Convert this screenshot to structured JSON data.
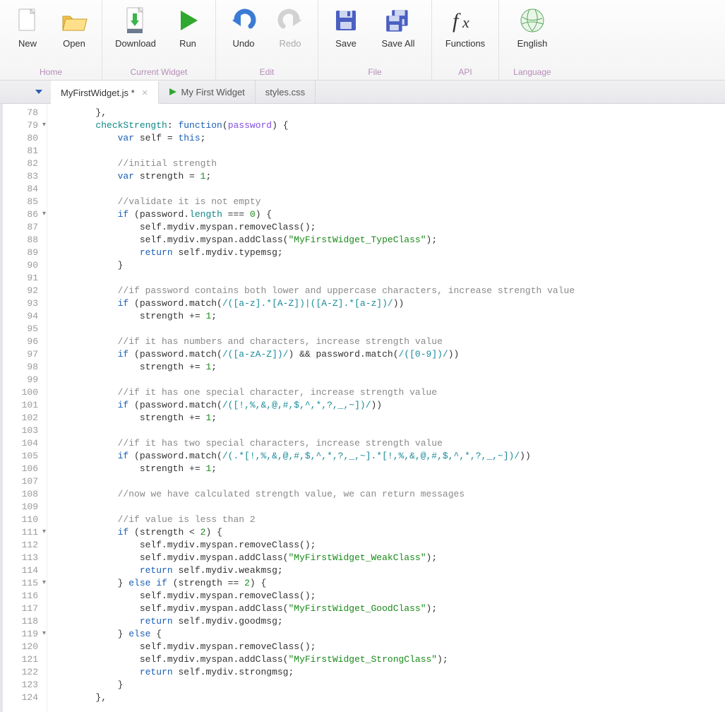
{
  "ribbon": {
    "groups": [
      {
        "label": "Home",
        "buttons": [
          {
            "id": "new",
            "label": "New"
          },
          {
            "id": "open",
            "label": "Open"
          }
        ]
      },
      {
        "label": "Current Widget",
        "buttons": [
          {
            "id": "download",
            "label": "Download"
          },
          {
            "id": "run",
            "label": "Run"
          }
        ]
      },
      {
        "label": "Edit",
        "buttons": [
          {
            "id": "undo",
            "label": "Undo"
          },
          {
            "id": "redo",
            "label": "Redo",
            "disabled": true
          }
        ]
      },
      {
        "label": "File",
        "buttons": [
          {
            "id": "save",
            "label": "Save"
          },
          {
            "id": "saveall",
            "label": "Save All"
          }
        ]
      },
      {
        "label": "API",
        "buttons": [
          {
            "id": "functions",
            "label": "Functions"
          }
        ]
      },
      {
        "label": "Language",
        "buttons": [
          {
            "id": "english",
            "label": "English"
          }
        ]
      }
    ]
  },
  "tabs": {
    "items": [
      {
        "label": "MyFirstWidget.js *",
        "active": true,
        "close": "×"
      },
      {
        "label": "My First Widget",
        "runnable": true
      },
      {
        "label": "styles.css"
      }
    ]
  },
  "editor": {
    "first_line": 78,
    "fold_lines": [
      79,
      86,
      111,
      115,
      119
    ],
    "lines": [
      [
        {
          "t": "        },",
          "c": ""
        }
      ],
      [
        {
          "t": "        ",
          "c": ""
        },
        {
          "t": "checkStrength",
          "c": "k-teal"
        },
        {
          "t": ": ",
          "c": ""
        },
        {
          "t": "function",
          "c": "k-blue"
        },
        {
          "t": "(",
          "c": ""
        },
        {
          "t": "password",
          "c": "k-purp"
        },
        {
          "t": ") {",
          "c": ""
        }
      ],
      [
        {
          "t": "            ",
          "c": ""
        },
        {
          "t": "var",
          "c": "k-blue"
        },
        {
          "t": " self = ",
          "c": ""
        },
        {
          "t": "this",
          "c": "k-blue"
        },
        {
          "t": ";",
          "c": ""
        }
      ],
      [
        {
          "t": "",
          "c": ""
        }
      ],
      [
        {
          "t": "            ",
          "c": ""
        },
        {
          "t": "//initial strength",
          "c": "k-com"
        }
      ],
      [
        {
          "t": "            ",
          "c": ""
        },
        {
          "t": "var",
          "c": "k-blue"
        },
        {
          "t": " strength = ",
          "c": ""
        },
        {
          "t": "1",
          "c": "k-num"
        },
        {
          "t": ";",
          "c": ""
        }
      ],
      [
        {
          "t": "",
          "c": ""
        }
      ],
      [
        {
          "t": "            ",
          "c": ""
        },
        {
          "t": "//validate it is not empty",
          "c": "k-com"
        }
      ],
      [
        {
          "t": "            ",
          "c": ""
        },
        {
          "t": "if",
          "c": "k-blue"
        },
        {
          "t": " (password.",
          "c": ""
        },
        {
          "t": "length",
          "c": "k-teal"
        },
        {
          "t": " === ",
          "c": ""
        },
        {
          "t": "0",
          "c": "k-num"
        },
        {
          "t": ") {",
          "c": ""
        }
      ],
      [
        {
          "t": "                self.mydiv.myspan.removeClass();",
          "c": ""
        }
      ],
      [
        {
          "t": "                self.mydiv.myspan.addClass(",
          "c": ""
        },
        {
          "t": "\"MyFirstWidget_TypeClass\"",
          "c": "k-str"
        },
        {
          "t": ");",
          "c": ""
        }
      ],
      [
        {
          "t": "                ",
          "c": ""
        },
        {
          "t": "return",
          "c": "k-blue"
        },
        {
          "t": " self.mydiv.typemsg;",
          "c": ""
        }
      ],
      [
        {
          "t": "            }",
          "c": ""
        }
      ],
      [
        {
          "t": "",
          "c": ""
        }
      ],
      [
        {
          "t": "            ",
          "c": ""
        },
        {
          "t": "//if password contains both lower and uppercase characters, increase strength value",
          "c": "k-com"
        }
      ],
      [
        {
          "t": "            ",
          "c": ""
        },
        {
          "t": "if",
          "c": "k-blue"
        },
        {
          "t": " (password.match(",
          "c": ""
        },
        {
          "t": "/([a-z].*[A-Z])|([A-Z].*[a-z])/",
          "c": "k-regex"
        },
        {
          "t": "))",
          "c": ""
        }
      ],
      [
        {
          "t": "                strength += ",
          "c": ""
        },
        {
          "t": "1",
          "c": "k-num"
        },
        {
          "t": ";",
          "c": ""
        }
      ],
      [
        {
          "t": "",
          "c": ""
        }
      ],
      [
        {
          "t": "            ",
          "c": ""
        },
        {
          "t": "//if it has numbers and characters, increase strength value",
          "c": "k-com"
        }
      ],
      [
        {
          "t": "            ",
          "c": ""
        },
        {
          "t": "if",
          "c": "k-blue"
        },
        {
          "t": " (password.match(",
          "c": ""
        },
        {
          "t": "/([a-zA-Z])/",
          "c": "k-regex"
        },
        {
          "t": ") && password.match(",
          "c": ""
        },
        {
          "t": "/([0-9])/",
          "c": "k-regex"
        },
        {
          "t": "))",
          "c": ""
        }
      ],
      [
        {
          "t": "                strength += ",
          "c": ""
        },
        {
          "t": "1",
          "c": "k-num"
        },
        {
          "t": ";",
          "c": ""
        }
      ],
      [
        {
          "t": "",
          "c": ""
        }
      ],
      [
        {
          "t": "            ",
          "c": ""
        },
        {
          "t": "//if it has one special character, increase strength value",
          "c": "k-com"
        }
      ],
      [
        {
          "t": "            ",
          "c": ""
        },
        {
          "t": "if",
          "c": "k-blue"
        },
        {
          "t": " (password.match(",
          "c": ""
        },
        {
          "t": "/([!,%,&,@,#,$,^,*,?,_,~])/",
          "c": "k-regex"
        },
        {
          "t": "))",
          "c": ""
        }
      ],
      [
        {
          "t": "                strength += ",
          "c": ""
        },
        {
          "t": "1",
          "c": "k-num"
        },
        {
          "t": ";",
          "c": ""
        }
      ],
      [
        {
          "t": "",
          "c": ""
        }
      ],
      [
        {
          "t": "            ",
          "c": ""
        },
        {
          "t": "//if it has two special characters, increase strength value",
          "c": "k-com"
        }
      ],
      [
        {
          "t": "            ",
          "c": ""
        },
        {
          "t": "if",
          "c": "k-blue"
        },
        {
          "t": " (password.match(",
          "c": ""
        },
        {
          "t": "/(.*[!,%,&,@,#,$,^,*,?,_,~].*[!,%,&,@,#,$,^,*,?,_,~])/",
          "c": "k-regex"
        },
        {
          "t": "))",
          "c": ""
        }
      ],
      [
        {
          "t": "                strength += ",
          "c": ""
        },
        {
          "t": "1",
          "c": "k-num"
        },
        {
          "t": ";",
          "c": ""
        }
      ],
      [
        {
          "t": "",
          "c": ""
        }
      ],
      [
        {
          "t": "            ",
          "c": ""
        },
        {
          "t": "//now we have calculated strength value, we can return messages",
          "c": "k-com"
        }
      ],
      [
        {
          "t": "",
          "c": ""
        }
      ],
      [
        {
          "t": "            ",
          "c": ""
        },
        {
          "t": "//if value is less than 2",
          "c": "k-com"
        }
      ],
      [
        {
          "t": "            ",
          "c": ""
        },
        {
          "t": "if",
          "c": "k-blue"
        },
        {
          "t": " (strength < ",
          "c": ""
        },
        {
          "t": "2",
          "c": "k-num"
        },
        {
          "t": ") {",
          "c": ""
        }
      ],
      [
        {
          "t": "                self.mydiv.myspan.removeClass();",
          "c": ""
        }
      ],
      [
        {
          "t": "                self.mydiv.myspan.addClass(",
          "c": ""
        },
        {
          "t": "\"MyFirstWidget_WeakClass\"",
          "c": "k-str"
        },
        {
          "t": ");",
          "c": ""
        }
      ],
      [
        {
          "t": "                ",
          "c": ""
        },
        {
          "t": "return",
          "c": "k-blue"
        },
        {
          "t": " self.mydiv.weakmsg;",
          "c": ""
        }
      ],
      [
        {
          "t": "            } ",
          "c": ""
        },
        {
          "t": "else",
          "c": "k-blue"
        },
        {
          "t": " ",
          "c": ""
        },
        {
          "t": "if",
          "c": "k-blue"
        },
        {
          "t": " (strength == ",
          "c": ""
        },
        {
          "t": "2",
          "c": "k-num"
        },
        {
          "t": ") {",
          "c": ""
        }
      ],
      [
        {
          "t": "                self.mydiv.myspan.removeClass();",
          "c": ""
        }
      ],
      [
        {
          "t": "                self.mydiv.myspan.addClass(",
          "c": ""
        },
        {
          "t": "\"MyFirstWidget_GoodClass\"",
          "c": "k-str"
        },
        {
          "t": ");",
          "c": ""
        }
      ],
      [
        {
          "t": "                ",
          "c": ""
        },
        {
          "t": "return",
          "c": "k-blue"
        },
        {
          "t": " self.mydiv.goodmsg;",
          "c": ""
        }
      ],
      [
        {
          "t": "            } ",
          "c": ""
        },
        {
          "t": "else",
          "c": "k-blue"
        },
        {
          "t": " {",
          "c": ""
        }
      ],
      [
        {
          "t": "                self.mydiv.myspan.removeClass();",
          "c": ""
        }
      ],
      [
        {
          "t": "                self.mydiv.myspan.addClass(",
          "c": ""
        },
        {
          "t": "\"MyFirstWidget_StrongClass\"",
          "c": "k-str"
        },
        {
          "t": ");",
          "c": ""
        }
      ],
      [
        {
          "t": "                ",
          "c": ""
        },
        {
          "t": "return",
          "c": "k-blue"
        },
        {
          "t": " self.mydiv.strongmsg;",
          "c": ""
        }
      ],
      [
        {
          "t": "            }",
          "c": ""
        }
      ],
      [
        {
          "t": "        },",
          "c": ""
        }
      ]
    ]
  }
}
